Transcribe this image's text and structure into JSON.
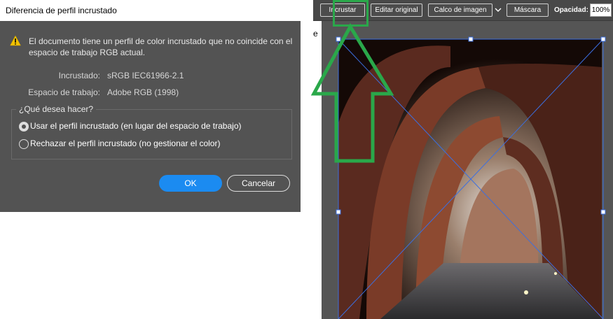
{
  "dialog": {
    "title": "Diferencia de perfil incrustado",
    "warning_icon": "warning-icon",
    "message": "El documento tiene un perfil de color incrustado que no coincide con el espacio de trabajo RGB actual.",
    "embedded_label": "Incrustado:",
    "embedded_value": "sRGB IEC61966-2.1",
    "workspace_label": "Espacio de trabajo:",
    "workspace_value": "Adobe RGB (1998)",
    "question": "¿Qué desea hacer?",
    "options": [
      {
        "label": "Usar el perfil incrustado (en lugar del espacio de trabajo)",
        "selected": true
      },
      {
        "label": "Rechazar el perfil incrustado (no gestionar el color)",
        "selected": false
      }
    ],
    "ok_label": "OK",
    "cancel_label": "Cancelar"
  },
  "toolbar": {
    "embed_label": "Incrustar",
    "edit_original_label": "Editar original",
    "image_trace_label": "Calco de imagen",
    "mask_label": "Máscara",
    "opacity_label": "Opacidad:",
    "opacity_value": "100%"
  },
  "document": {
    "tab_fragment": "e (",
    "image_icon": "photo-arches-icon"
  },
  "colors": {
    "annotation_green": "#2aa84a",
    "selection_blue": "#3b6fe0",
    "ok_blue": "#1b8bf1"
  }
}
